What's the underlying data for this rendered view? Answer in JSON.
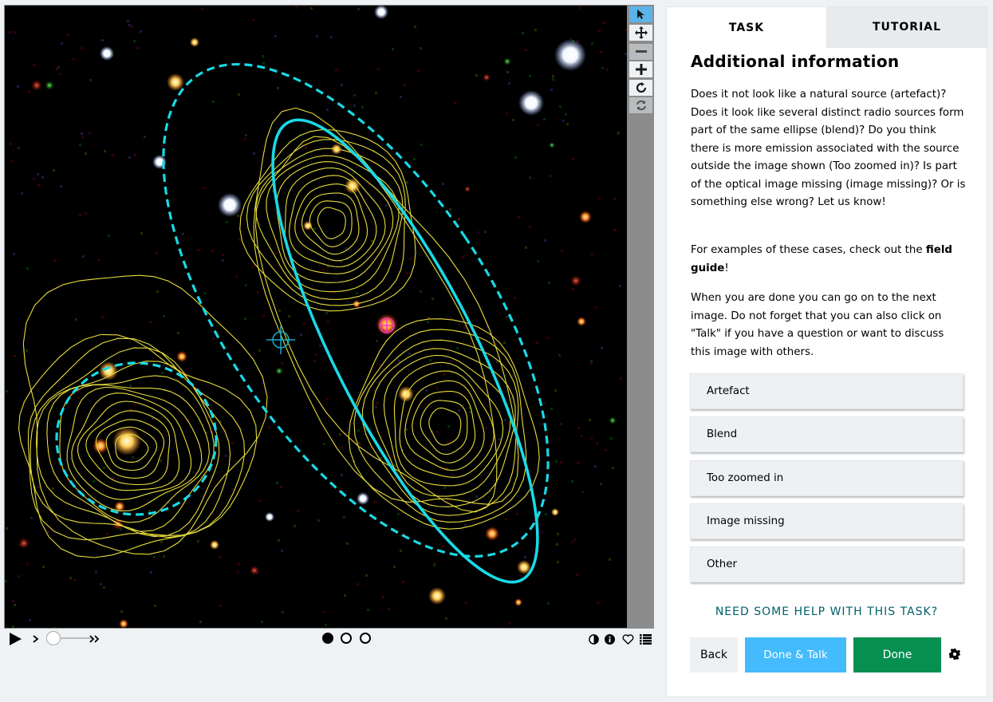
{
  "tabs": {
    "task": "TASK",
    "tutorial": "TUTORIAL"
  },
  "task": {
    "title": "Additional information",
    "p1": "Does it not look like a natural source (artefact)? Does it look like several distinct radio sources form part of the same ellipse (blend)? Do you think there is more emission associated with the source outside the image shown (Too zoomed in)? Is part of the optical image missing (image missing)? Or is something else wrong? Let us know!",
    "p2_prefix": "For examples of these cases, check out the ",
    "p2_bold": "field guide",
    "p2_suffix": "!",
    "p3": "When you are done you can go on to the next image. Do not forget that you can also click on \"Talk\" if you have a question or want to discuss this image with others.",
    "answers": [
      "Artefact",
      "Blend",
      "Too zoomed in",
      "Image missing",
      "Other"
    ],
    "help": "NEED SOME HELP WITH THIS TASK?",
    "back": "Back",
    "done_talk": "Done & Talk",
    "done": "Done"
  },
  "viewer": {
    "tools": [
      "pointer-icon",
      "pan-icon",
      "zoom-out-icon",
      "zoom-in-icon",
      "rotate-icon",
      "reset-icon"
    ],
    "frames": 3,
    "current_frame": 1,
    "colors": {
      "annotation": "#19d9e6",
      "contour": "#e6dc3c",
      "background": "#000000"
    }
  }
}
